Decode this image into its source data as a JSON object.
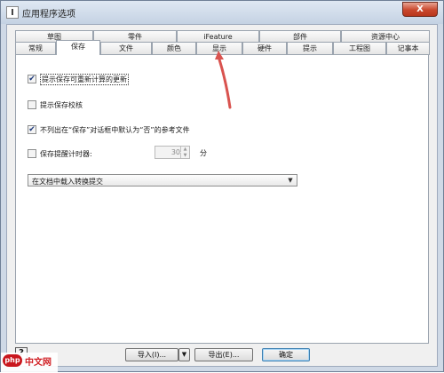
{
  "window": {
    "title": "应用程序选项",
    "app_icon_glyph": "I",
    "close_glyph": "X"
  },
  "tabs_row1": [
    "草图",
    "零件",
    "iFeature",
    "部件",
    "资源中心"
  ],
  "tabs_row2": [
    "常规",
    "保存",
    "文件",
    "颜色",
    "显示",
    "硬件",
    "提示",
    "工程图",
    "记事本"
  ],
  "active_tab": "保存",
  "options": {
    "prompt_resave": {
      "label": "提示保存可重新计算的更新",
      "checked": true
    },
    "prompt_checkin": {
      "label": "提示保存校核",
      "checked": false
    },
    "exclude_ref_files": {
      "label": "不列出在“保存”对话框中默认为“否”的参考文件",
      "checked": true
    },
    "save_reminder_timer": {
      "label": "保存提醒计时器:",
      "checked": false
    }
  },
  "timer": {
    "value": "30",
    "unit": "分"
  },
  "select": {
    "value": "在文档中载入转换提交"
  },
  "buttons": {
    "help_glyph": "?",
    "import_label": "导入(I)...",
    "export_label": "导出(E)...",
    "ok_label": "确定",
    "dropdown_glyph": "▼"
  },
  "watermark": {
    "badge": "php",
    "text": "中文网"
  },
  "colors": {
    "annotation_arrow": "#d9534f",
    "close_button": "#c9472d",
    "checkmark": "#1f3a7a"
  }
}
